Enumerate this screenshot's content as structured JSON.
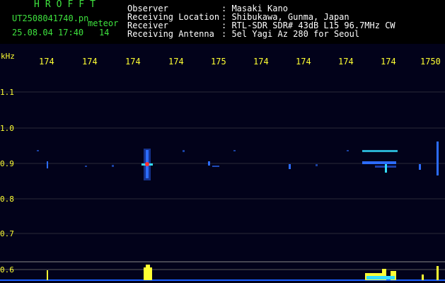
{
  "header": {
    "brand": "HROFFT",
    "filename": "UT2508041740.pn",
    "tag": "meteor",
    "datetime": "25.08.04 17:40",
    "count": "14",
    "fields": [
      {
        "label": "Observer",
        "value": ": Masaki Kano"
      },
      {
        "label": "Receiving Location",
        "value": ": Shibukawa, Gunma, Japan"
      },
      {
        "label": "Receiver",
        "value": ": RTL-SDR SDR# 43dB L15 96.7MHz CW"
      },
      {
        "label": "Receiving Antenna",
        "value": ": 5el Yagi Az 280 for Seoul"
      }
    ]
  },
  "axis": {
    "unit": "kHz",
    "top_ticks": [
      "174",
      "174",
      "174",
      "174",
      "175",
      "174",
      "174",
      "174",
      "174",
      "1750"
    ],
    "y_ticks": [
      "1.1",
      "1.0",
      "0.9",
      "0.8",
      "0.7",
      "0.6"
    ]
  },
  "colors": {
    "text_green": "#3ee23e",
    "text_yellow": "#ffff33",
    "signal_blue": "#2c6cff",
    "signal_cyan": "#33ddff",
    "signal_red": "#ff3030",
    "grid": "#303040"
  }
}
